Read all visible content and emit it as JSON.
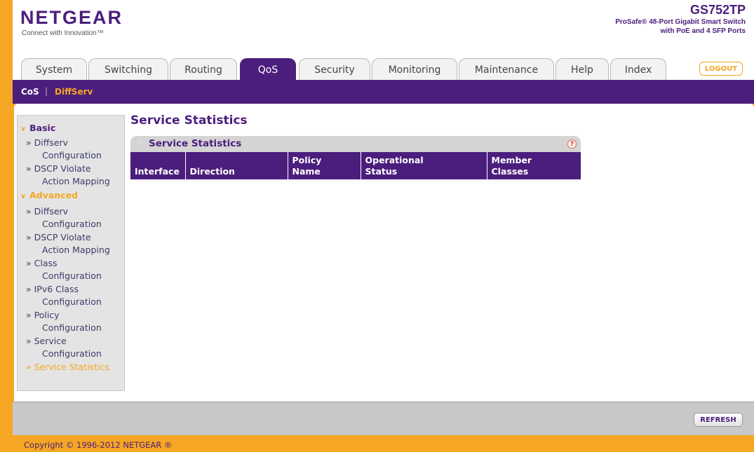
{
  "brand": {
    "logo": "NETGEAR",
    "tagline": "Connect with Innovation™",
    "model": "GS752TP",
    "description_line1": "ProSafe® 48-Port Gigabit Smart Switch",
    "description_line2": "with PoE and 4 SFP Ports"
  },
  "tabs": [
    "System",
    "Switching",
    "Routing",
    "QoS",
    "Security",
    "Monitoring",
    "Maintenance",
    "Help",
    "Index"
  ],
  "active_tab": "QoS",
  "logout_label": "LOGOUT",
  "subnav": {
    "items": [
      "CoS",
      "DiffServ"
    ],
    "separator": "|",
    "active": "DiffServ"
  },
  "sidebar": {
    "sections": [
      {
        "label": "Basic",
        "items": [
          {
            "line1": "Diffserv",
            "line2": "Configuration"
          },
          {
            "line1": "DSCP Violate",
            "line2": "Action Mapping"
          }
        ]
      },
      {
        "label": "Advanced",
        "items": [
          {
            "line1": "Diffserv",
            "line2": "Configuration"
          },
          {
            "line1": "DSCP Violate",
            "line2": "Action Mapping"
          },
          {
            "line1": "Class",
            "line2": "Configuration"
          },
          {
            "line1": "IPv6 Class",
            "line2": "Configuration"
          },
          {
            "line1": "Policy",
            "line2": "Configuration"
          },
          {
            "line1": "Service",
            "line2": "Configuration"
          },
          {
            "line1": "Service Statistics",
            "line2": ""
          }
        ]
      }
    ],
    "active_item": "Service Statistics"
  },
  "page": {
    "title": "Service Statistics",
    "panel_title": "Service Statistics",
    "help_glyph": "?",
    "columns": [
      {
        "line1": "Interface",
        "line2": ""
      },
      {
        "line1": "Direction",
        "line2": ""
      },
      {
        "line1": "Policy",
        "line2": "Name"
      },
      {
        "line1": "Operational",
        "line2": "Status"
      },
      {
        "line1": "Member",
        "line2": "Classes"
      }
    ],
    "rows": []
  },
  "refresh_label": "REFRESH",
  "copyright": "Copyright © 1996-2012 NETGEAR ®",
  "colors": {
    "brand_purple": "#4b1e7d",
    "accent_orange": "#f5a623",
    "panel_gray": "#d4d4d4",
    "footer_gray": "#c8c8c8"
  }
}
